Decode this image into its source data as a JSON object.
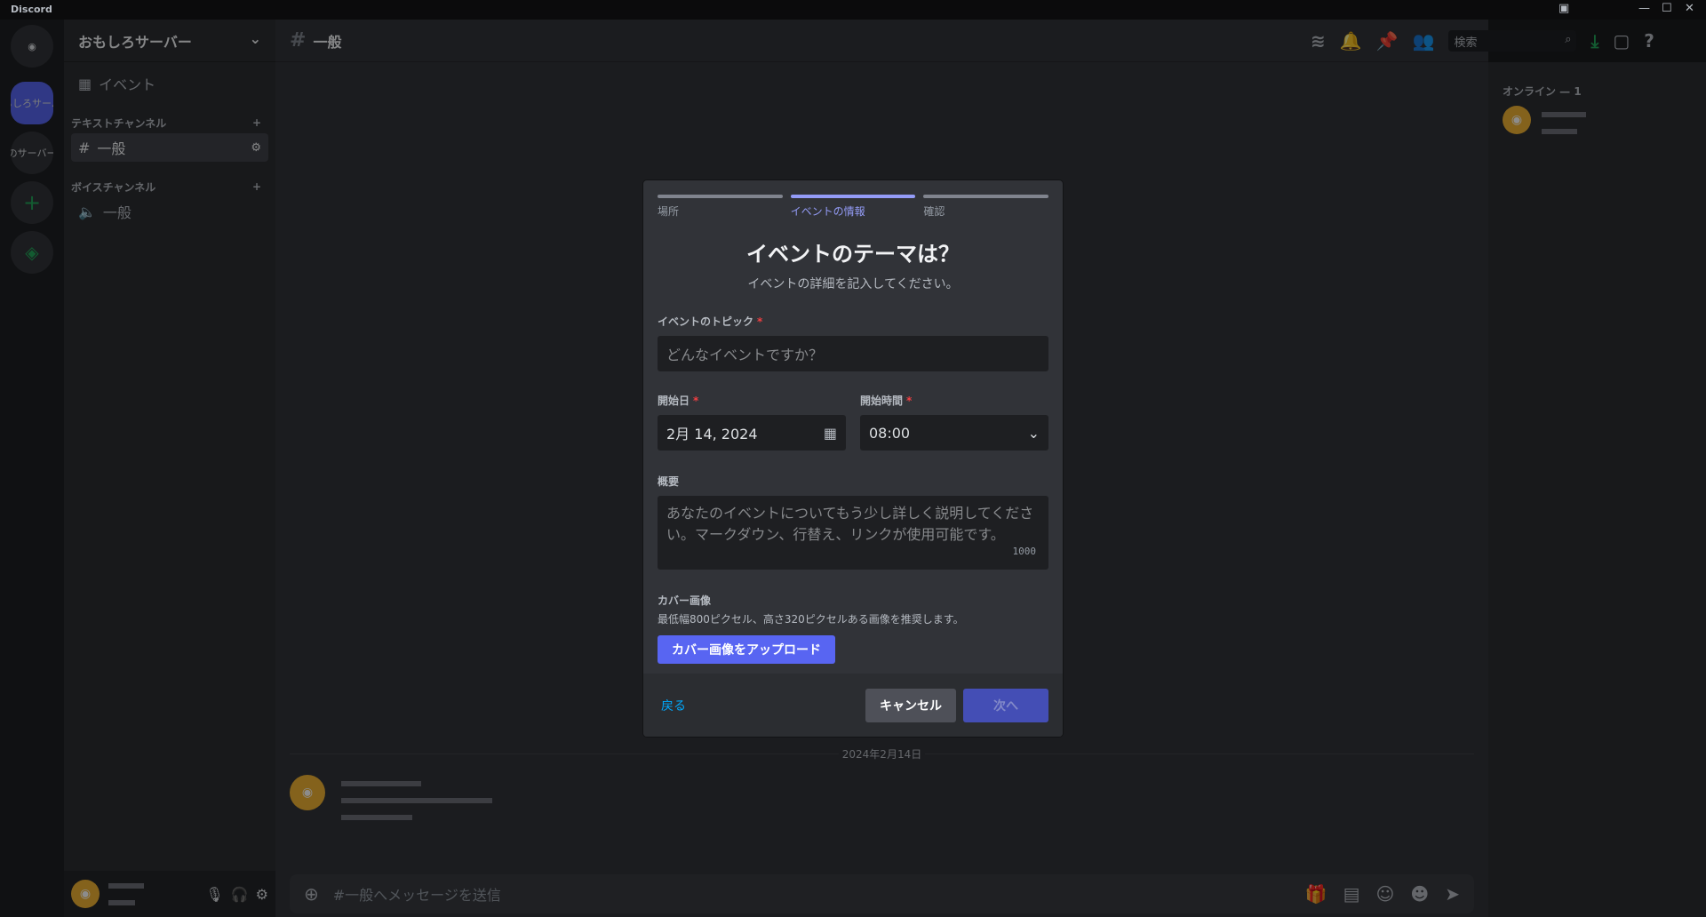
{
  "app": {
    "title": "Discord"
  },
  "rail": {
    "servers": [
      "おもしろサーバー",
      "のサーバー"
    ]
  },
  "sidebar": {
    "server_name": "おもしろサーバー",
    "events": "イベント",
    "categories": [
      {
        "name": "テキストチャンネル",
        "channels": [
          "一般"
        ]
      },
      {
        "name": "ボイスチャンネル",
        "channels": [
          "一般"
        ]
      }
    ]
  },
  "header": {
    "channel": "一般",
    "search_placeholder": "検索"
  },
  "members": {
    "online_label": "オンライン — 1"
  },
  "chat": {
    "date_divider": "2024年2月14日",
    "composer_placeholder": "#一般へメッセージを送信"
  },
  "modal": {
    "steps": [
      "場所",
      "イベントの情報",
      "確認"
    ],
    "active_step": 1,
    "title": "イベントのテーマは？",
    "subtitle": "イベントの詳細を記入してください。",
    "topic_label": "イベントのトピック",
    "topic_placeholder": "どんなイベントですか？",
    "date_label": "開始日",
    "date_value": "2月 14, 2024",
    "time_label": "開始時間",
    "time_value": "08:00",
    "desc_label": "概要",
    "desc_placeholder": "あなたのイベントについてもう少し詳しく説明してください。マークダウン、行替え、リンクが使用可能です。",
    "desc_counter": "1000",
    "cover_label": "カバー画像",
    "cover_hint": "最低幅800ピクセル、高さ320ピクセルある画像を推奨します。",
    "upload_label": "カバー画像をアップロード",
    "back": "戻る",
    "cancel": "キャンセル",
    "next": "次へ"
  }
}
